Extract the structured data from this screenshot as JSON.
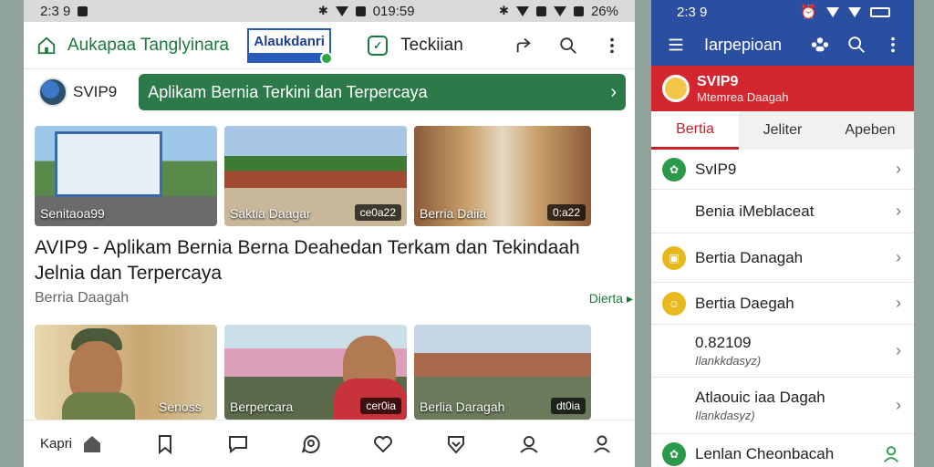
{
  "left": {
    "status": {
      "time": "2:3 9",
      "center_time": "019:59",
      "right_text": "26%"
    },
    "topbar": {
      "title": "Aukapaa Tanglyinara",
      "brand": "Alaukdanri",
      "tek_label": "Teckiian"
    },
    "subbar": {
      "svip": "SVIP9",
      "banner": "Aplikam Bernia Terkini dan Terpercaya"
    },
    "thumbs_row1": [
      {
        "caption": "Senitaoa99",
        "badge": ""
      },
      {
        "caption": "Saktia Daagar",
        "badge": "ce0a22"
      },
      {
        "caption": "Berria Daiia",
        "badge": "0:a22"
      }
    ],
    "headline": "AVIP9 - Aplikam Bernia Berna Deahedan Terkam dan Tekindaah Jelnia dan Terpercaya",
    "meta": {
      "source": "Berria Daagah",
      "more": "Dierta ▸"
    },
    "thumbs_row2": [
      {
        "caption": "Senoss",
        "badge": ""
      },
      {
        "caption": "Berpercara",
        "badge": "cer0ia"
      },
      {
        "caption": "Berlia Daragah",
        "badge": "dt0ia"
      }
    ],
    "bottomnav": {
      "label": "Kapri"
    }
  },
  "right": {
    "status": {
      "time": "2:3 9"
    },
    "appbar": {
      "title": "Iarpepioan"
    },
    "header": {
      "name": "SVIP9",
      "subtitle": "Mtemrea Daagah"
    },
    "tabs": [
      {
        "label": "Bertia",
        "active": true
      },
      {
        "label": "Jeliter",
        "active": false
      },
      {
        "label": "Apeben",
        "active": false
      }
    ],
    "items": [
      {
        "title": "SvIP9",
        "sub": "",
        "icon_color": "#2a9a4a"
      },
      {
        "title": "Benia iMeblaceat",
        "sub": "",
        "icon_color": ""
      },
      {
        "title": "Bertia Danagah",
        "sub": "",
        "icon_color": "#e8b91e"
      },
      {
        "title": "Bertia Daegah",
        "sub": "",
        "icon_color": "#e8b91e"
      },
      {
        "title": "0.82109",
        "sub": "Ilankkdasyz)",
        "icon_color": ""
      },
      {
        "title": "Atlaouic iaa Dagah",
        "sub": "Ilankdasyz)",
        "icon_color": ""
      },
      {
        "title": "Lenlan Cheonbacah",
        "sub": "",
        "icon_color": "#2a9a4a"
      }
    ]
  }
}
